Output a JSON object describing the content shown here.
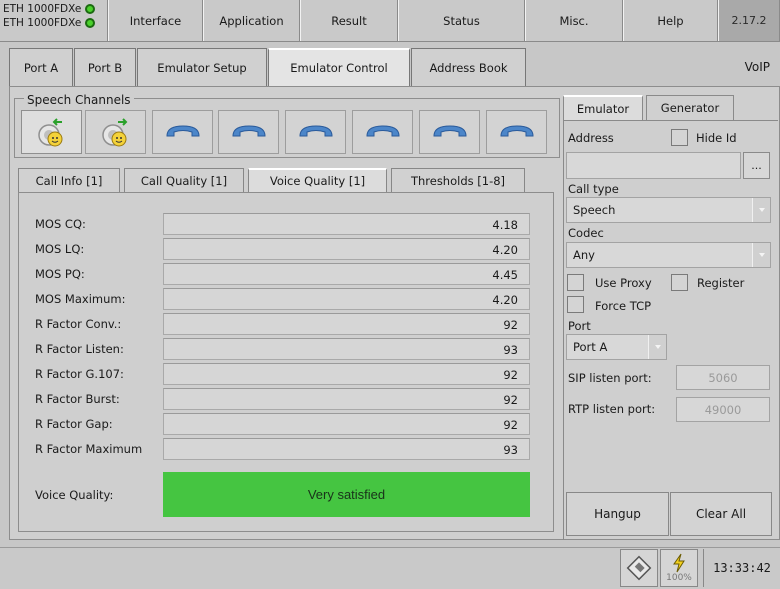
{
  "topbar": {
    "port_lines": [
      "ETH 1000FDXe",
      "ETH 1000FDXe"
    ],
    "menu": [
      "Interface",
      "Application",
      "Result",
      "Status",
      "Misc.",
      "Help"
    ],
    "version": "2.17.2"
  },
  "tabs": {
    "items": [
      "Port A",
      "Port B",
      "Emulator Setup",
      "Emulator Control",
      "Address Book"
    ],
    "active": "Emulator Control",
    "right_label": "VoIP"
  },
  "speech_channels": {
    "title": "Speech Channels",
    "channels": [
      "active-call-incoming",
      "active-call-outgoing",
      "idle",
      "idle",
      "idle",
      "idle",
      "idle",
      "idle"
    ]
  },
  "subtabs": {
    "items": [
      "Call Info [1]",
      "Call Quality [1]",
      "Voice Quality [1]",
      "Thresholds [1-8]"
    ],
    "active": "Voice Quality [1]"
  },
  "metrics": [
    {
      "label": "MOS CQ:",
      "value": "4.18"
    },
    {
      "label": "MOS LQ:",
      "value": "4.20"
    },
    {
      "label": "MOS PQ:",
      "value": "4.45"
    },
    {
      "label": "MOS Maximum:",
      "value": "4.20"
    },
    {
      "label": "R Factor Conv.:",
      "value": "92"
    },
    {
      "label": "R Factor Listen:",
      "value": "93"
    },
    {
      "label": "R Factor G.107:",
      "value": "92"
    },
    {
      "label": "R Factor Burst:",
      "value": "92"
    },
    {
      "label": "R Factor Gap:",
      "value": "92"
    },
    {
      "label": "R Factor Maximum",
      "value": "93"
    }
  ],
  "voice_quality": {
    "label": "Voice Quality:",
    "value": "Very satisfied",
    "color": "#45c541"
  },
  "right_panel": {
    "tabs": [
      "Emulator",
      "Generator"
    ],
    "active_tab": "Emulator",
    "address_label": "Address",
    "hide_id_label": "Hide Id",
    "address_value": "",
    "browse_label": "...",
    "call_type_label": "Call type",
    "call_type_value": "Speech",
    "codec_label": "Codec",
    "codec_value": "Any",
    "use_proxy_label": "Use Proxy",
    "register_label": "Register",
    "force_tcp_label": "Force TCP",
    "port_label": "Port",
    "port_value": "Port A",
    "sip_label": "SIP listen port:",
    "sip_value": "5060",
    "rtp_label": "RTP listen port:",
    "rtp_value": "49000",
    "hangup_label": "Hangup",
    "clear_label": "Clear All"
  },
  "statusbar": {
    "battery_percent": "100%",
    "time": "13:33:42"
  }
}
